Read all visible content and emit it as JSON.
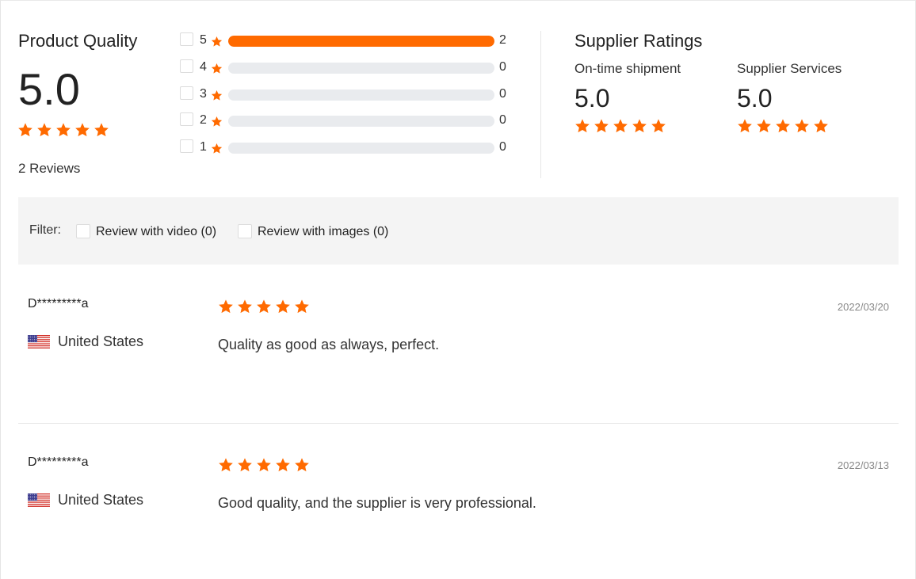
{
  "product_quality": {
    "title": "Product Quality",
    "score": "5.0",
    "stars": 5,
    "reviews_count_label": "2 Reviews"
  },
  "distribution": [
    {
      "rating": "5",
      "count": "2",
      "fraction": 1.0
    },
    {
      "rating": "4",
      "count": "0",
      "fraction": 0
    },
    {
      "rating": "3",
      "count": "0",
      "fraction": 0
    },
    {
      "rating": "2",
      "count": "0",
      "fraction": 0
    },
    {
      "rating": "1",
      "count": "0",
      "fraction": 0
    }
  ],
  "supplier_ratings": {
    "title": "Supplier Ratings",
    "items": [
      {
        "label": "On-time shipment",
        "score": "5.0",
        "stars": 5
      },
      {
        "label": "Supplier Services",
        "score": "5.0",
        "stars": 5
      }
    ]
  },
  "filter": {
    "label": "Filter:",
    "options": [
      {
        "label": "Review with video (0)",
        "checked": false
      },
      {
        "label": "Review with images (0)",
        "checked": false
      }
    ]
  },
  "reviews": [
    {
      "name": "D*********a",
      "country": "United States",
      "flag_icon": "us-flag-icon",
      "stars": 5,
      "date": "2022/03/20",
      "comment": "Quality as good as always, perfect."
    },
    {
      "name": "D*********a",
      "country": "United States",
      "flag_icon": "us-flag-icon",
      "stars": 5,
      "date": "2022/03/13",
      "comment": "Good quality, and the supplier is very professional."
    }
  ],
  "colors": {
    "accent": "#ff6a00",
    "track": "#e9ebee",
    "filter_bg": "#f4f4f4"
  },
  "icons": {
    "star": "star-icon",
    "flag": "us-flag-icon"
  }
}
